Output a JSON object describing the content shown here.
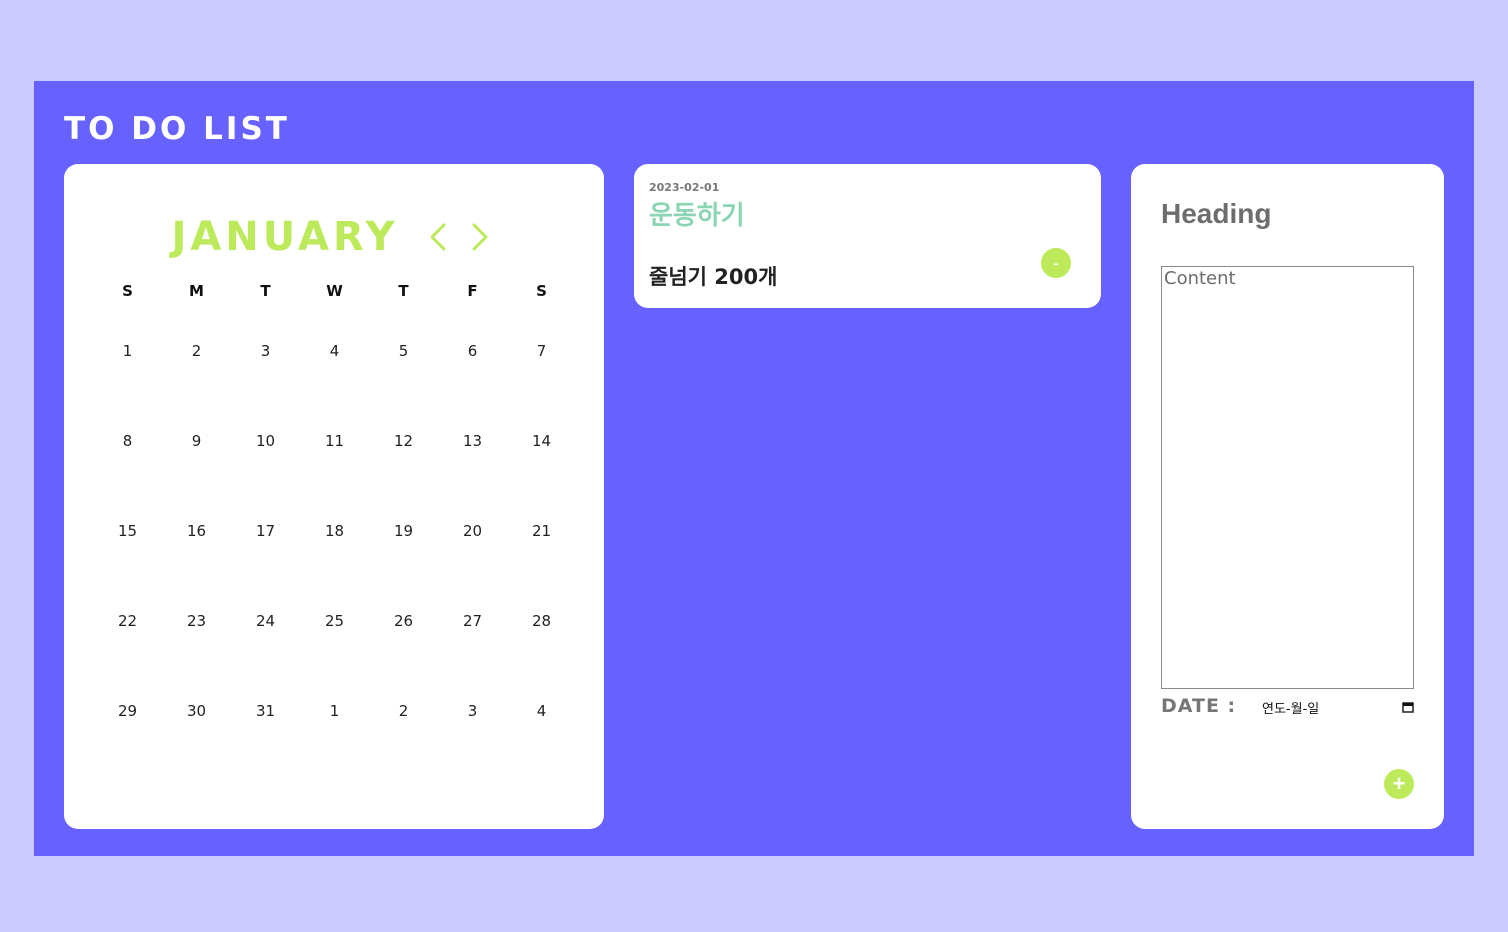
{
  "app": {
    "title": "TO DO LIST"
  },
  "calendar": {
    "month": "JANUARY",
    "prev_icon": "chevron-left-icon",
    "next_icon": "chevron-right-icon",
    "weekdays": [
      "S",
      "M",
      "T",
      "W",
      "T",
      "F",
      "S"
    ],
    "weeks": [
      [
        "1",
        "2",
        "3",
        "4",
        "5",
        "6",
        "7"
      ],
      [
        "8",
        "9",
        "10",
        "11",
        "12",
        "13",
        "14"
      ],
      [
        "15",
        "16",
        "17",
        "18",
        "19",
        "20",
        "21"
      ],
      [
        "22",
        "23",
        "24",
        "25",
        "26",
        "27",
        "28"
      ],
      [
        "29",
        "30",
        "31",
        "1",
        "2",
        "3",
        "4"
      ]
    ]
  },
  "todos": [
    {
      "date": "2023-02-01",
      "title": "운동하기",
      "content": "줄넘기 200개",
      "remove_label": "-"
    }
  ],
  "form": {
    "heading_placeholder": "Heading",
    "content_placeholder": "Content",
    "date_label": "DATE :",
    "date_placeholder": "연도-월-일",
    "add_label": "+"
  },
  "colors": {
    "background": "#cccbff",
    "panel": "#6761ff",
    "accent": "#bdea5a",
    "todo_title": "#8cd5b4"
  }
}
